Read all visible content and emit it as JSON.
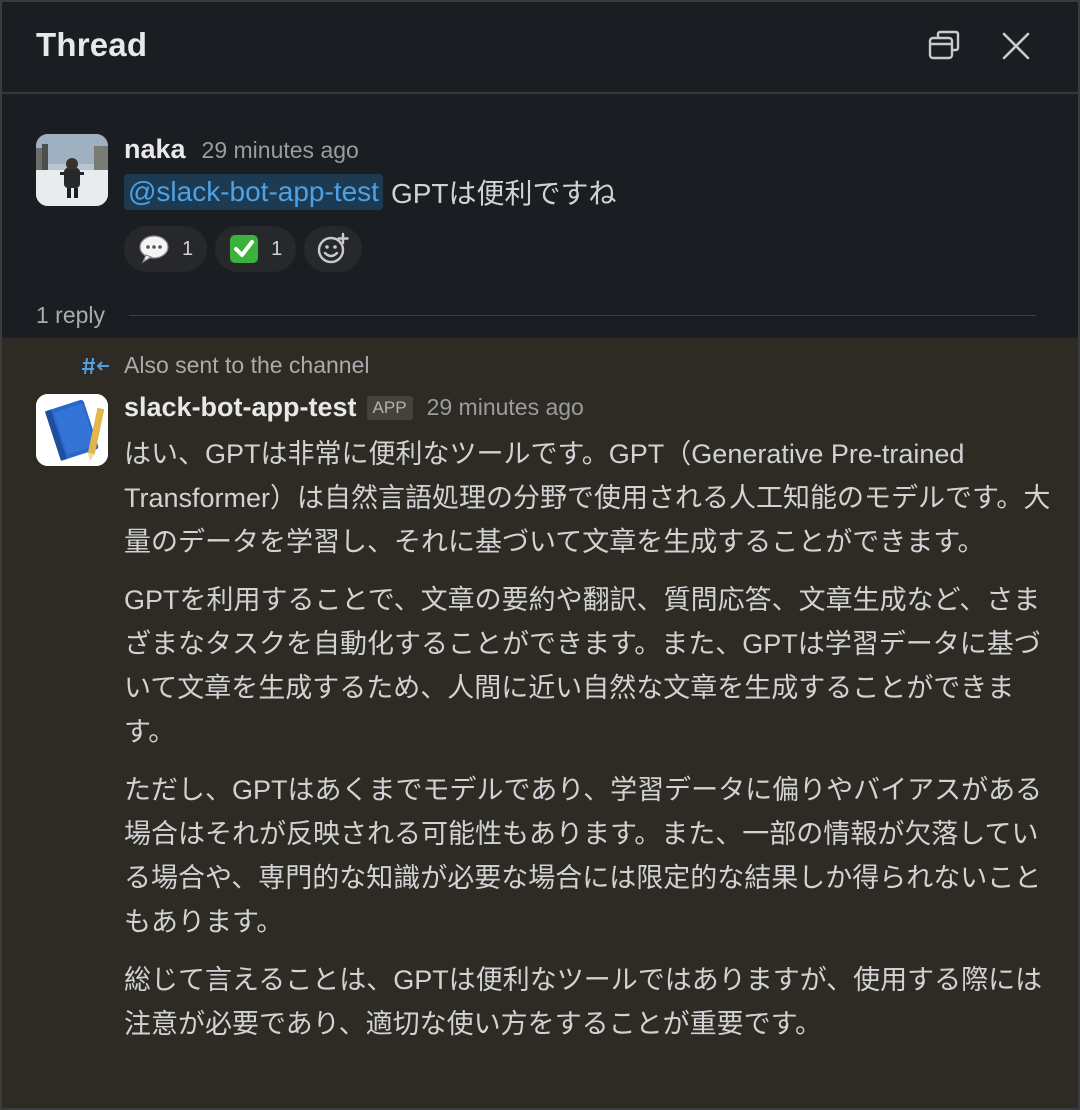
{
  "header": {
    "title": "Thread",
    "popout_icon": "popout-icon",
    "close_icon": "close-icon"
  },
  "parent_message": {
    "author": "naka",
    "timestamp": "29 minutes ago",
    "mention": "@slack-bot-app-test",
    "text": "GPTは便利ですね",
    "reactions": [
      {
        "icon": "speech-bubble-emoji",
        "count": "1"
      },
      {
        "icon": "white-check-mark-emoji",
        "count": "1"
      }
    ],
    "add_reaction_icon": "add-reaction-icon"
  },
  "reply_summary": {
    "count_label": "1 reply"
  },
  "reply_message": {
    "also_sent": "Also sent to the channel",
    "author": "slack-bot-app-test",
    "badge": "APP",
    "timestamp": "29 minutes ago",
    "paragraphs": [
      "はい、GPTは非常に便利なツールです。GPT（Generative Pre-trained Transformer）は自然言語処理の分野で使用される人工知能のモデルです。大量のデータを学習し、それに基づいて文章を生成することができます。",
      "GPTを利用することで、文章の要約や翻訳、質問応答、文章生成など、さまざまなタスクを自動化することができます。また、GPTは学習データに基づいて文章を生成するため、人間に近い自然な文章を生成することができます。",
      "ただし、GPTはあくまでモデルであり、学習データに偏りやバイアスがある場合はそれが反映される可能性もあります。また、一部の情報が欠落している場合や、専門的な知識が必要な場合には限定的な結果しか得られないこともあります。",
      "総じて言えることは、GPTは便利なツールではありますが、使用する際には注意が必要であり、適切な使い方をすることが重要です。"
    ]
  },
  "colors": {
    "background": "#1a1d21",
    "reply_highlight": "#2e2b25",
    "mention_text": "#4ea1e3",
    "mention_bg": "#1c3a52"
  }
}
